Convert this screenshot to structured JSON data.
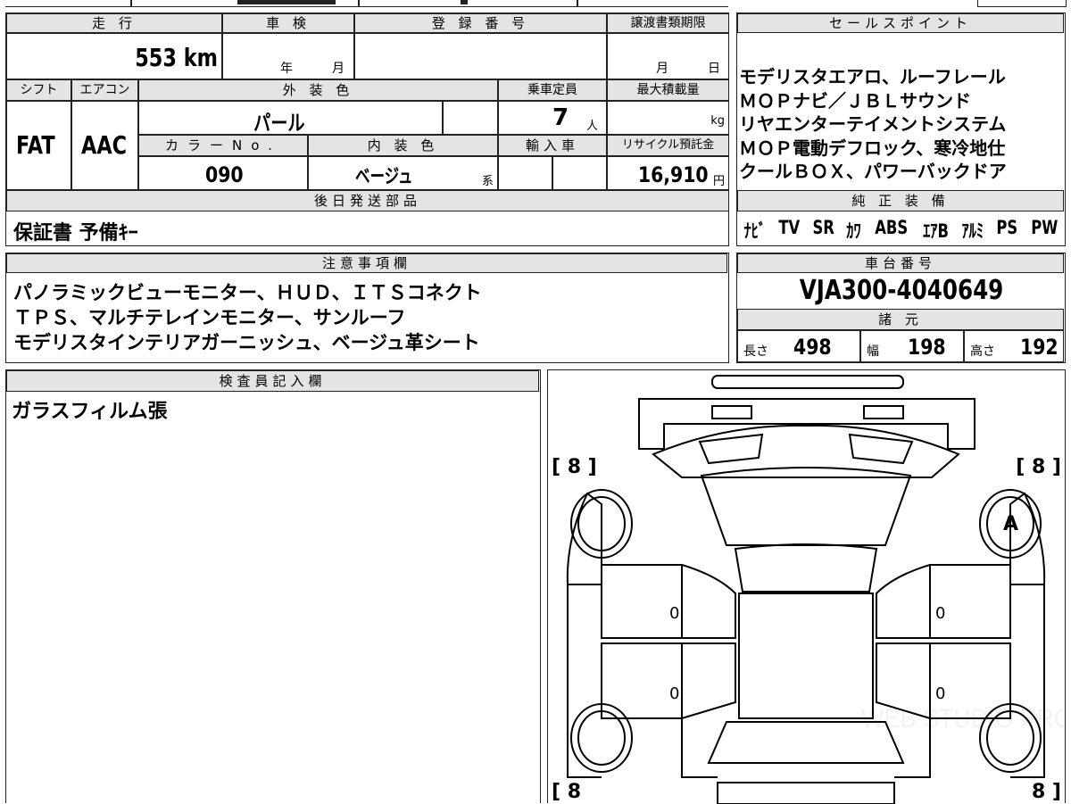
{
  "top_partial": "",
  "labels": {
    "mileage": "走 行",
    "inspection": "車 検",
    "registration": "登 録 番 号",
    "transfer_deadline": "譲渡書類期限",
    "sales_points": "セールスポイント",
    "shift": "シフト",
    "aircon": "エアコン",
    "exterior_color": "外 装 色",
    "capacity": "乗車定員",
    "max_load": "最大積載量",
    "color_no": "カラーNo.",
    "interior_color": "内 装 色",
    "import": "輸入車",
    "recycle": "リサイクル預託金",
    "later_parts": "後日発送部品",
    "genuine_equipment": "純 正 装 備",
    "notes": "注意事項欄",
    "chassis_no": "車台番号",
    "specs": "諸 元",
    "inspector": "検査員記入欄",
    "year_unit": "年",
    "month_unit": "月",
    "month_unit2": "月",
    "day_unit": "日",
    "person_unit": "人",
    "kg_unit": "kg",
    "yen_unit": "円",
    "kei_unit": "系",
    "length": "長さ",
    "width": "幅",
    "height": "高さ"
  },
  "values": {
    "mileage": "553 km",
    "shift": "FAT",
    "aircon": "AAC",
    "exterior_color": "パール",
    "capacity": "7",
    "color_no": "090",
    "interior_color": "ベージュ",
    "recycle": "16,910",
    "chassis_no": "VJA300-4040649",
    "length": "498",
    "width": "198",
    "height": "192"
  },
  "sales_points": [
    "モデリスタエアロ、ルーフレール",
    "ＭＯＰナビ／ＪＢＬサウンド",
    "リヤエンターテイメントシステム",
    "ＭＯＰ電動デフロック、寒冷地仕",
    "クールＢＯＸ、パワーバックドア"
  ],
  "later_parts": "保証書 予備ｷｰ",
  "equipment": [
    "ﾅﾋﾞ",
    "TV",
    "SR",
    "ｶﾜ",
    "ABS",
    "ｴｱB",
    "ｱﾙﾐ",
    "PS",
    "PW"
  ],
  "notes": [
    "パノラミックビューモニター、ＨＵＤ、ＩＴＳコネクト",
    "ＴＰＳ、マルチテレインモニター、サンルーフ",
    "モデリスタインテリアガーニッシュ、ベージュ革シート"
  ],
  "inspector_notes": "ガラスフィルム張",
  "diagram": {
    "tread_fl": "[ 8 ]",
    "tread_fr": "[ 8 ]",
    "tread_rl": "[ 8",
    "tread_rr": "8 ]",
    "wheel_mark_fr": "A",
    "door_fl": "0",
    "door_rl": "0",
    "door_fr": "0",
    "door_rr": "0",
    "watermark": "WEB STUDIO PRO"
  }
}
